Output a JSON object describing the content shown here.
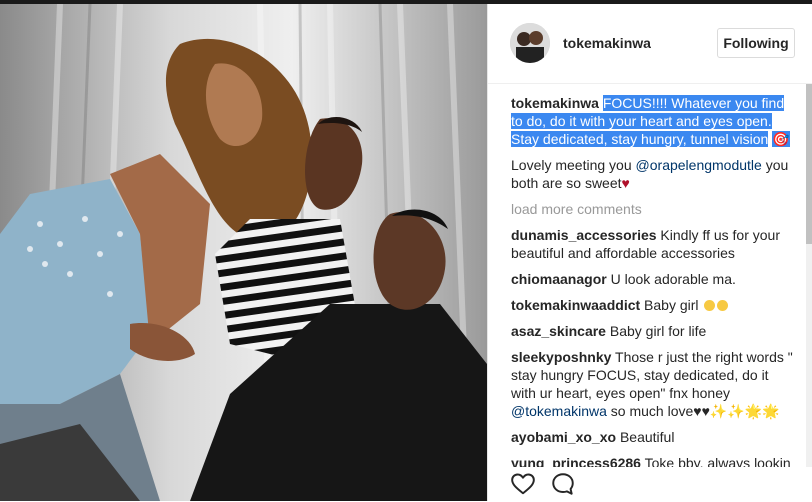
{
  "post": {
    "username": "tokemakinwa",
    "follow_label": "Following"
  },
  "caption": {
    "username": "tokemakinwa",
    "text": "FOCUS!!!! Whatever you find to do, do it with your heart and eyes open. Stay dedicated, stay hungry, tunnel vision",
    "trailing": "🎯"
  },
  "comments": [
    {
      "username": "",
      "text": "Lovely meeting you ",
      "mention": "@orapelengmodutle",
      "text2": " you both are so sweet",
      "heart": "♥"
    },
    {
      "load_more": "load more comments"
    },
    {
      "username": "dunamis_accessories",
      "text": "Kindly ff us for your beautiful and affordable accessories"
    },
    {
      "username": "chiomaanagor",
      "text": "U look adorable ma."
    },
    {
      "username": "tokemakinwaaddict",
      "text": "Baby girl"
    },
    {
      "username": "asaz_skincare",
      "text": "Baby girl for life"
    },
    {
      "username": "sleekyposhnky",
      "text": "Those r just the right words \" stay hungry FOCUS, stay dedicated, do it with ur heart, eyes open\" fnx honey ",
      "mention": "@tokemakinwa",
      "text2": " so much love",
      "hearts": "♥♥",
      "sparkles": "✨✨🌟🌟"
    },
    {
      "username": "ayobami_xo_xo",
      "text": "Beautiful"
    },
    {
      "username": "yung_princess6286",
      "text": "Toke bby, always lookin"
    }
  ],
  "icons": {
    "like": "heart-outline-icon",
    "comment": "comment-bubble-icon"
  }
}
